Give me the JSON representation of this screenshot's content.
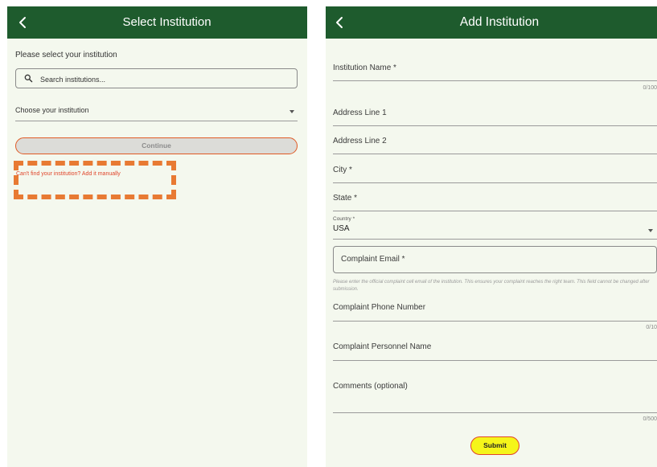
{
  "select_screen": {
    "title": "Select Institution",
    "prompt": "Please select your institution",
    "search_placeholder": "Search institutions...",
    "dropdown_value": "Choose your institution",
    "continue_label": "Continue",
    "manual_link": "Can't find your institution? Add it manually",
    "icons": [
      "back-arrow-icon",
      "search-icon",
      "caret-down-icon"
    ]
  },
  "add_screen": {
    "title": "Add Institution",
    "institution_name_label": "Institution Name *",
    "institution_name_counter": "0/100",
    "address1_label": "Address Line 1",
    "address2_label": "Address Line 2",
    "city_label": "City *",
    "state_label": "State *",
    "country_label": "Country *",
    "country_value": "USA",
    "complaint_email_label": "Complaint Email *",
    "complaint_email_helper": "Please enter the official complaint cell email of the institution. This ensures your complaint reaches the right team. This field cannot be changed after submission.",
    "phone_label": "Complaint Phone Number",
    "phone_counter": "0/10",
    "personnel_label": "Complaint Personnel Name",
    "comments_label": "Comments (optional)",
    "comments_counter": "0/500",
    "submit_label": "Submit"
  },
  "colors": {
    "app_bar": "#1e5b2d",
    "background": "#f4f8ee",
    "highlight_orange": "#e87a33",
    "link_red": "#e0452a",
    "submit_yellow": "#f5f51a"
  }
}
